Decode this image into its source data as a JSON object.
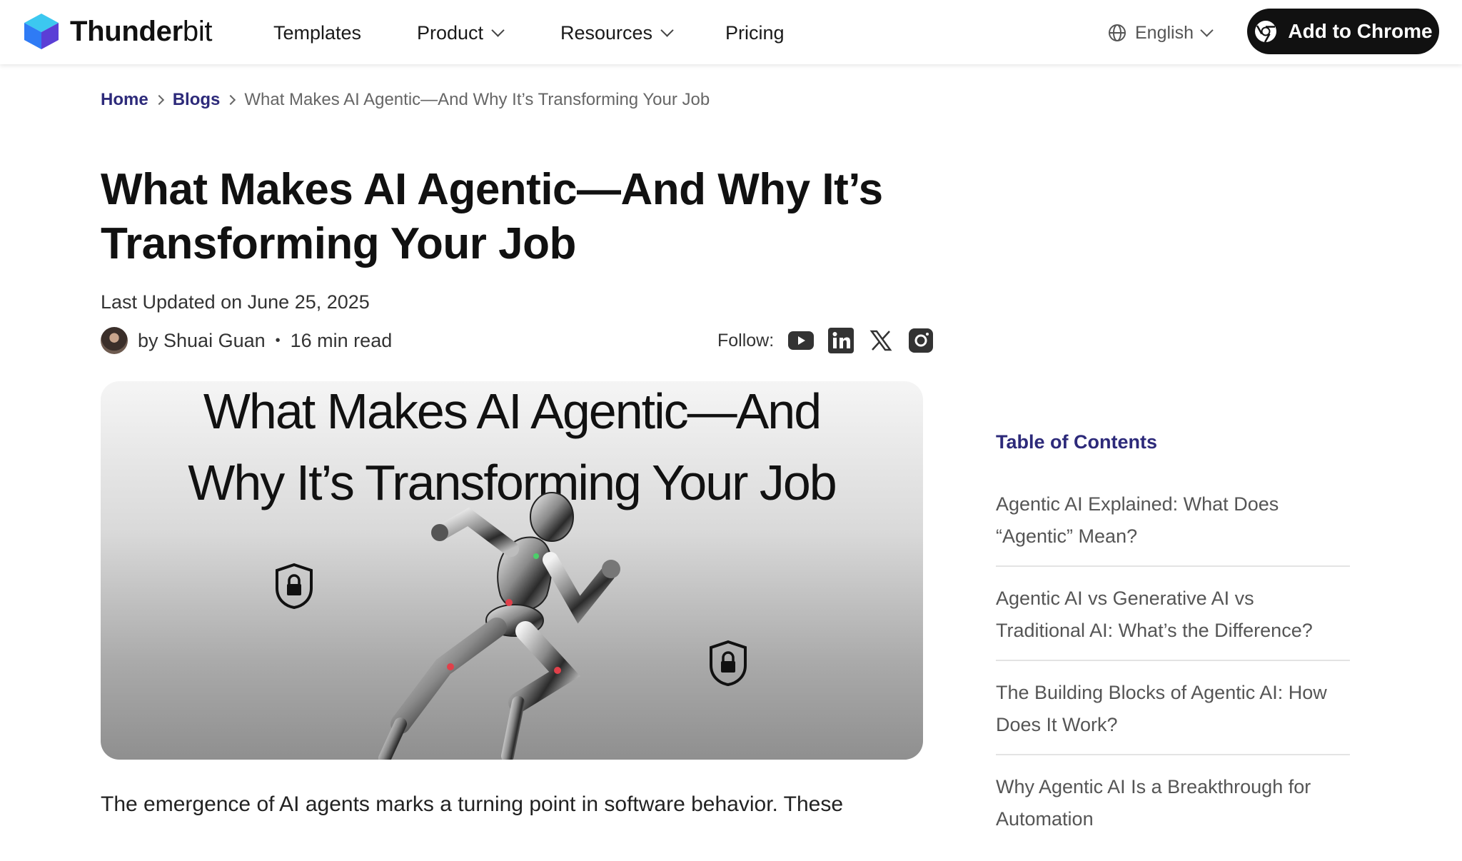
{
  "header": {
    "brand_bold": "Thunder",
    "brand_light": "bit",
    "nav": [
      {
        "label": "Templates"
      },
      {
        "label": "Product"
      },
      {
        "label": "Resources"
      },
      {
        "label": "Pricing"
      }
    ],
    "language": "English",
    "cta_label": "Add to Chrome"
  },
  "breadcrumb": {
    "items": [
      "Home",
      "Blogs"
    ],
    "current": "What Makes AI Agentic—And Why It’s Transforming Your Job"
  },
  "article": {
    "title_line1": "What Makes AI Agentic—And Why It’s",
    "title_line2": "Transforming Your Job",
    "updated": "Last Updated on June 25, 2025",
    "author": "by Shuai Guan",
    "read_time": "16 min read",
    "follow_label": "Follow:",
    "hero_line1": "What Makes AI Agentic—And",
    "hero_line2": "Why It’s Transforming Your Job",
    "intro": "The emergence of AI agents marks a turning point in software behavior. These"
  },
  "toc": {
    "heading": "Table of Contents",
    "items": [
      {
        "line1": "Agentic AI Explained: What Does",
        "line2": "“Agentic” Mean?"
      },
      {
        "line1": "Agentic AI vs Generative AI vs",
        "line2": "Traditional AI: What’s the Difference?"
      },
      {
        "line1": "The Building Blocks of Agentic AI: How",
        "line2": "Does It Work?"
      },
      {
        "line1": "Why Agentic AI Is a Breakthrough for",
        "line2": "Automation"
      }
    ]
  },
  "colors": {
    "accent": "#2d2a7a",
    "cta_bg": "#111111",
    "logo_blue": "#2f7bf5",
    "logo_cyan": "#3cc8f0"
  },
  "icons": [
    "thunderbit-logo-icon",
    "chevron-down-icon",
    "globe-icon",
    "chrome-icon",
    "youtube-icon",
    "linkedin-icon",
    "x-icon",
    "instagram-icon",
    "lock-shield-icon"
  ]
}
